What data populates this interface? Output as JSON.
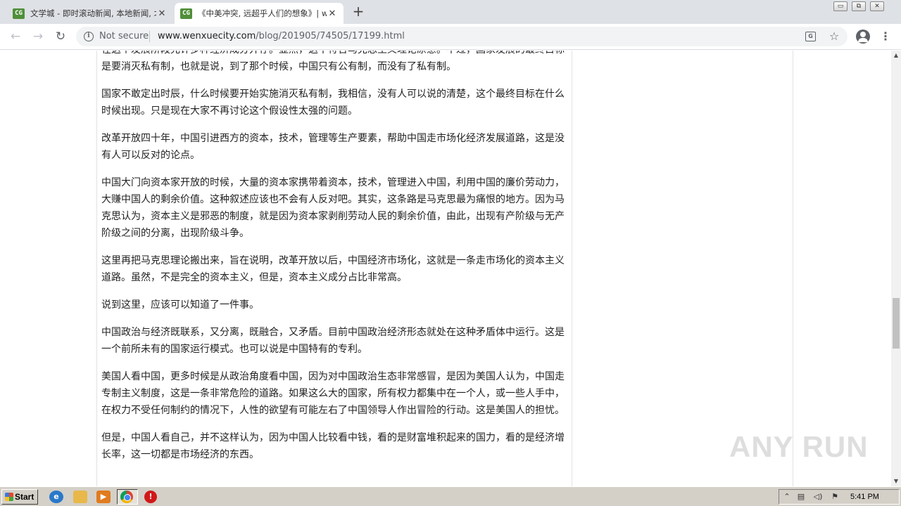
{
  "browser": {
    "tabs": [
      {
        "title": "文学城 - 即时滚动新闻, 本地新闻, 北",
        "active": false
      },
      {
        "title": "《中美冲突, 远超乎人们的想象》| we",
        "active": true
      }
    ],
    "favicon_text": "CG",
    "new_tab_label": "+",
    "security_label": "Not secure",
    "url_host": "www.wenxuecity.com",
    "url_path": "/blog/201905/74505/17199.html"
  },
  "article": {
    "paragraphs": [
      "在这个发展阶段允许多种经济成分并存。显然，这不符合马克思主义理论原意。不过，国家发展的最终目标是要消灭私有制，也就是说，到了那个时候，中国只有公有制，而没有了私有制。",
      "国家不敢定出时辰，什么时候要开始实施消灭私有制，我相信，没有人可以说的清楚，这个最终目标在什么时候出现。只是现在大家不再讨论这个假设性太强的问题。",
      "改革开放四十年，中国引进西方的资本，技术，管理等生产要素，帮助中国走市场化经济发展道路，这是没有人可以反对的论点。",
      "中国大门向资本家开放的时候，大量的资本家携带着资本，技术，管理进入中国，利用中国的廉价劳动力，大赚中国人的剩余价值。这种叙述应该也不会有人反对吧。其实，这条路是马克思最为痛恨的地方。因为马克思认为，资本主义是邪恶的制度，就是因为资本家剥削劳动人民的剩余价值，由此，出现有产阶级与无产阶级之间的分离，出现阶级斗争。",
      "这里再把马克思理论搬出来，旨在说明，改革开放以后，中国经济市场化，这就是一条走市场化的资本主义道路。虽然，不是完全的资本主义，但是，资本主义成分占比非常高。",
      "说到这里，应该可以知道了一件事。",
      "中国政治与经济既联系，又分离，既融合，又矛盾。目前中国政治经济形态就处在这种矛盾体中运行。这是一个前所未有的国家运行模式。也可以说是中国特有的专利。",
      "美国人看中国，更多时候是从政治角度看中国，因为对中国政治生态非常感冒，是因为美国人认为，中国走专制主义制度，这是一条非常危险的道路。如果这么大的国家，所有权力都集中在一个人，或一些人手中，在权力不受任何制约的情况下，人性的欲望有可能左右了中国领导人作出冒险的行动。这是美国人的担忧。",
      "但是，中国人看自己，并不这样认为，因为中国人比较看中钱，看的是财富堆积起来的国力，看的是经济增长率，这一切都是市场经济的东西。"
    ]
  },
  "watermark": "ANY RUN",
  "taskbar": {
    "start_label": "Start",
    "clock": "5:41 PM"
  }
}
